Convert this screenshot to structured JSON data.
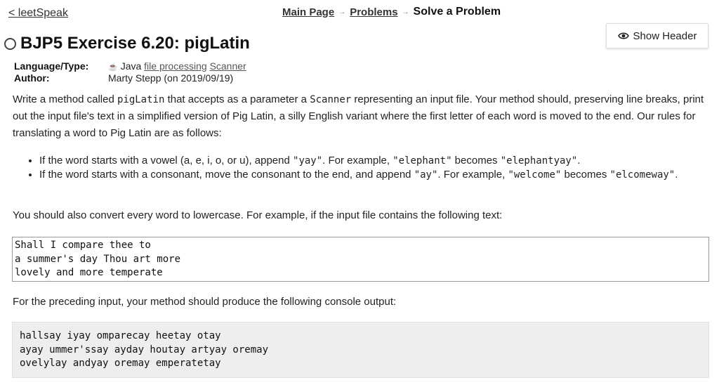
{
  "nav": {
    "back_link": "< leetSpeak",
    "breadcrumb": {
      "main_page": "Main Page",
      "problems": "Problems",
      "current": "Solve a Problem",
      "separator": "→"
    }
  },
  "header_toggle": {
    "icon": "eye-icon",
    "label": "Show Header"
  },
  "problem": {
    "title": "BJP5 Exercise 6.20: pigLatin",
    "status_icon": "radio-empty-icon",
    "meta": {
      "language_label": "Language/Type:",
      "language_icon": "java-icon",
      "language": "Java",
      "tags": [
        "file processing",
        "Scanner"
      ],
      "author_label": "Author:",
      "author": "Marty Stepp (on 2019/09/19)"
    },
    "description": {
      "p1_a": "Write a method called ",
      "p1_code1": "pigLatin",
      "p1_b": " that accepts as a parameter a ",
      "p1_code2": "Scanner",
      "p1_c": " representing an input file. Your method should, preserving line breaks, print out the input file's text in a simplified version of Pig Latin, a silly English variant where the first letter of each word is moved to the end. Our rules for translating a word to Pig Latin are as follows:",
      "rule1_a": "If the word starts with a vowel (a, e, i, o, or u), append ",
      "rule1_code1": "\"yay\"",
      "rule1_b": ". For example, ",
      "rule1_code2": "\"elephant\"",
      "rule1_c": " becomes ",
      "rule1_code3": "\"elephantyay\"",
      "rule1_d": ".",
      "rule2_a": "If the word starts with a consonant, move the consonant to the end, and append ",
      "rule2_code1": "\"ay\"",
      "rule2_b": ". For example, ",
      "rule2_code2": "\"welcome\"",
      "rule2_c": " becomes ",
      "rule2_code3": "\"elcomeway\"",
      "rule2_d": ".",
      "p2": "You should also convert every word to lowercase. For example, if the input file contains the following text:",
      "input_text": "Shall I compare thee to\na summer's day Thou art more\nlovely and more temperate",
      "p3": "For the preceding input, your method should produce the following console output:",
      "output_text": "hallsay iyay omparecay heetay otay\nayay ummer'ssay ayday houtay artyay oremay\novelylay andyay oremay emperatetay"
    }
  }
}
